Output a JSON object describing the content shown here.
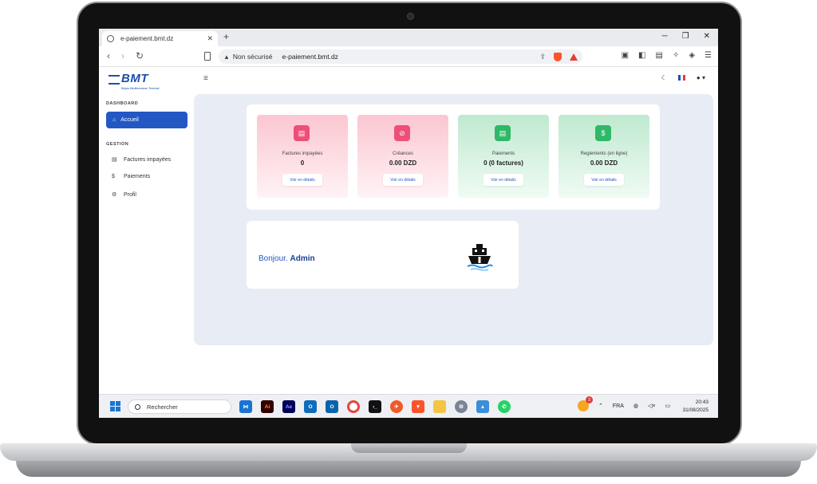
{
  "browser": {
    "tab_title": "e-paiement.bmt.dz",
    "tab_close": "✕",
    "new_tab": "+",
    "win_min": "─",
    "win_max": "❐",
    "win_close": "✕",
    "security_label": "Non sécurisé",
    "url": "e-paiement.bmt.dz"
  },
  "sidebar": {
    "logo_text": "BMT",
    "logo_sub": "Béjaia Mediterranean Terminal",
    "section_dashboard": "DASHBOARD",
    "active_item": "Accueil",
    "section_gestion": "GESTION",
    "items": [
      {
        "label": "Factures impayées",
        "icon": "file-icon"
      },
      {
        "label": "Paiements",
        "icon": "dollar-icon"
      },
      {
        "label": "Profil",
        "icon": "gear-icon"
      }
    ]
  },
  "stats": [
    {
      "label": "Factures impayées",
      "value": "0",
      "button": "Voir en détails",
      "color": "#ee4f78"
    },
    {
      "label": "Créances",
      "value": "0.00 DZD",
      "button": "Voir en détails",
      "color": "#ee4f78"
    },
    {
      "label": "Paiements",
      "value": "0 (0 factures)",
      "button": "Voir en détails",
      "color": "#2fb868"
    },
    {
      "label": "Reglements (en ligne)",
      "value": "0.00 DZD",
      "button": "Voir en détails",
      "color": "#2fb868"
    }
  ],
  "greeting": {
    "prefix": "Bonjour.",
    "name": "Admin"
  },
  "taskbar": {
    "search_placeholder": "Rechercher",
    "weather_badge": "3",
    "lang": "FRA",
    "time": "20:43",
    "date": "31/08/2025"
  },
  "colors": {
    "accent": "#2357c4",
    "pink": "#ee4f78",
    "green": "#2fb868"
  }
}
